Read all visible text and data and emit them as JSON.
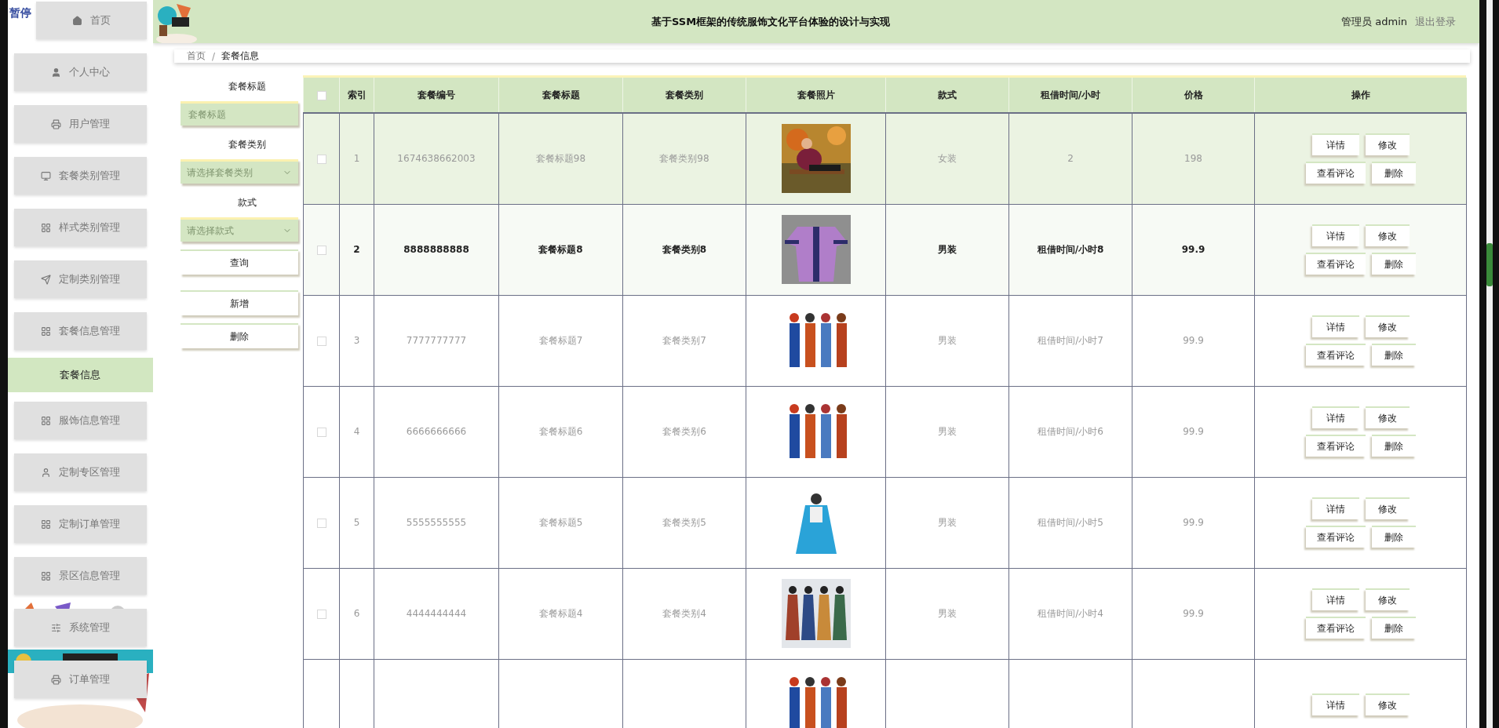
{
  "overlay": {
    "pause": "暂停"
  },
  "sidebar": {
    "items": [
      {
        "label": "首页"
      },
      {
        "label": "个人中心"
      },
      {
        "label": "用户管理"
      },
      {
        "label": "套餐类别管理"
      },
      {
        "label": "样式类别管理"
      },
      {
        "label": "定制类别管理"
      },
      {
        "label": "套餐信息管理",
        "children": [
          {
            "label": "套餐信息",
            "selected": true
          }
        ]
      },
      {
        "label": "服饰信息管理"
      },
      {
        "label": "定制专区管理"
      },
      {
        "label": "定制订单管理"
      },
      {
        "label": "景区信息管理"
      },
      {
        "label": "系统管理"
      },
      {
        "label": "订单管理"
      }
    ]
  },
  "header": {
    "title": "基于SSM框架的传统服饰文化平台体验的设计与实现",
    "user": "管理员 admin",
    "logout": "退出登录"
  },
  "breadcrumb": {
    "items": [
      "首页",
      "套餐信息"
    ],
    "separator": "/"
  },
  "filters": [
    {
      "kind": "text",
      "label": "套餐标题",
      "placeholder": "套餐标题"
    },
    {
      "kind": "select",
      "label": "套餐类别",
      "placeholder": "请选择套餐类别"
    },
    {
      "kind": "select",
      "label": "款式",
      "placeholder": "请选择款式"
    }
  ],
  "filter_buttons": [
    "查询",
    "新增",
    "删除"
  ],
  "table": {
    "all_checked": false,
    "columns": [
      "索引",
      "套餐编号",
      "套餐标题",
      "套餐类别",
      "套餐照片",
      "款式",
      "租借时间/小时",
      "价格",
      "操作"
    ],
    "rows": [
      {
        "striped": true,
        "hovered": false,
        "checked": false,
        "index": "1",
        "code": "1674638662003",
        "title": "套餐标题98",
        "category": "套餐类别98",
        "photo": {
          "kind": "picture"
        },
        "style": "女装",
        "rent": "2",
        "price": "198",
        "actions": [
          "详情",
          "修改",
          "查看评论",
          "删除"
        ]
      },
      {
        "striped": false,
        "hovered": true,
        "checked": false,
        "index": "2",
        "code": "8888888888",
        "title": "套餐标题8",
        "category": "套餐类别8",
        "photo": {
          "kind": "picture"
        },
        "style": "男装",
        "rent": "租借时间/小时8",
        "price": "99.9",
        "actions": [
          "详情",
          "修改",
          "查看评论",
          "删除"
        ]
      },
      {
        "striped": false,
        "hovered": false,
        "checked": false,
        "index": "3",
        "code": "7777777777",
        "title": "套餐标题7",
        "category": "套餐类别7",
        "photo": {
          "kind": "picture"
        },
        "style": "男装",
        "rent": "租借时间/小时7",
        "price": "99.9",
        "actions": [
          "详情",
          "修改",
          "查看评论",
          "删除"
        ]
      },
      {
        "striped": false,
        "hovered": false,
        "checked": false,
        "index": "4",
        "code": "6666666666",
        "title": "套餐标题6",
        "category": "套餐类别6",
        "photo": {
          "kind": "picture"
        },
        "style": "男装",
        "rent": "租借时间/小时6",
        "price": "99.9",
        "actions": [
          "详情",
          "修改",
          "查看评论",
          "删除"
        ]
      },
      {
        "striped": false,
        "hovered": false,
        "checked": false,
        "index": "5",
        "code": "5555555555",
        "title": "套餐标题5",
        "category": "套餐类别5",
        "photo": {
          "kind": "picture"
        },
        "style": "男装",
        "rent": "租借时间/小时5",
        "price": "99.9",
        "actions": [
          "详情",
          "修改",
          "查看评论",
          "删除"
        ]
      },
      {
        "striped": false,
        "hovered": false,
        "checked": false,
        "index": "6",
        "code": "4444444444",
        "title": "套餐标题4",
        "category": "套餐类别4",
        "photo": {
          "kind": "picture"
        },
        "style": "男装",
        "rent": "租借时间/小时4",
        "price": "99.9",
        "actions": [
          "详情",
          "修改",
          "查看评论",
          "删除"
        ]
      },
      {
        "photo": {
          "kind": "picture"
        },
        "actions": [
          "详情",
          "修改"
        ]
      }
    ]
  }
}
